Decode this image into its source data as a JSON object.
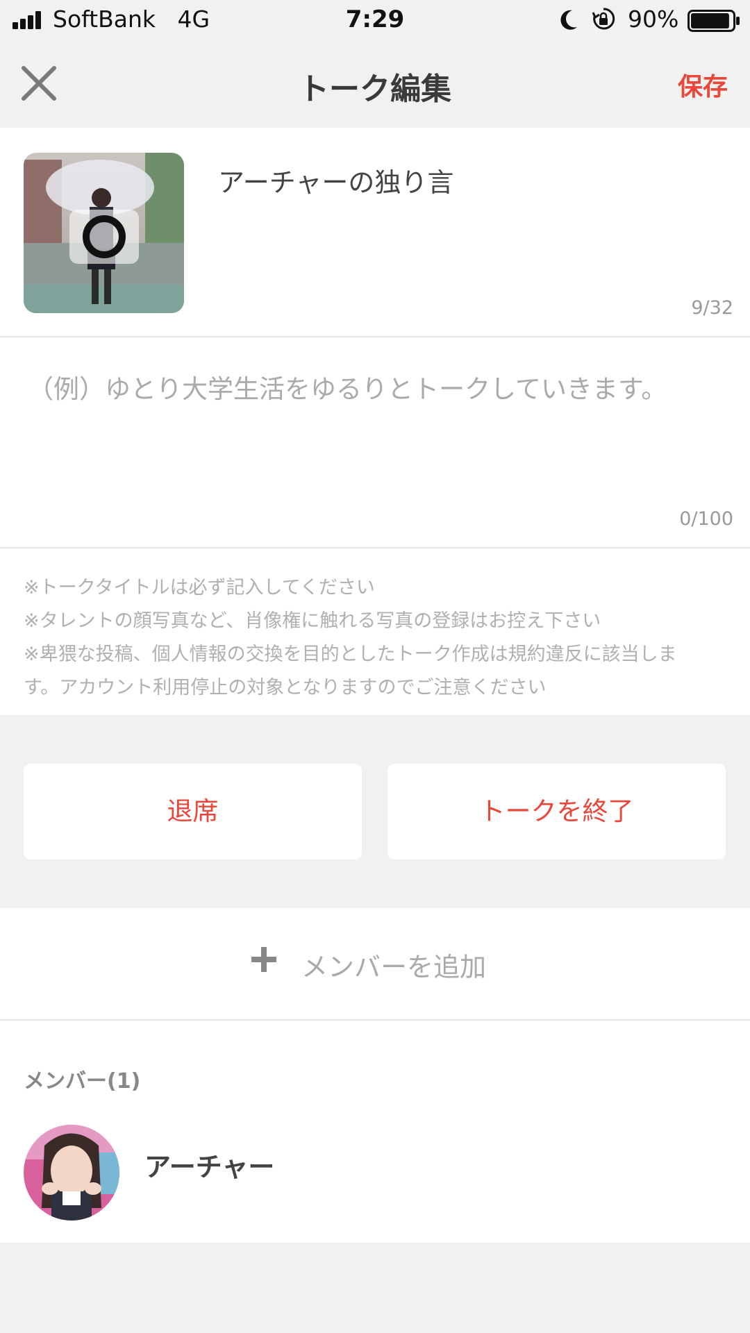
{
  "status_bar": {
    "carrier": "SoftBank",
    "network": "4G",
    "time": "7:29",
    "battery": "90%",
    "battery_level": 0.9
  },
  "nav": {
    "title": "トーク編集",
    "save_label": "保存",
    "close_icon": "close-icon"
  },
  "talk": {
    "title": "アーチャーの独り言",
    "title_counter": "9/32",
    "description_placeholder": "（例）ゆとり大学生活をゆるりとトークしていきます。",
    "description_counter": "0/100",
    "thumbnail_icon": "camera-icon"
  },
  "notes": [
    "※トークタイトルは必ず記入してください",
    "※タレントの顔写真など、肖像権に触れる写真の登録はお控え下さい",
    "※卑猥な投稿、個人情報の交換を目的としたトーク作成は規約違反に該当しま",
    "す。アカウント利用停止の対象となりますのでご注意ください"
  ],
  "actions": {
    "leave_label": "退席",
    "end_label": "トークを終了"
  },
  "add_member": {
    "label": "メンバーを追加",
    "icon": "plus-icon"
  },
  "members": {
    "header": "メンバー(1)",
    "list": [
      {
        "name": "アーチャー"
      }
    ]
  },
  "colors": {
    "accent": "#e8473a",
    "background": "#f1f1f1",
    "placeholder": "#aaaaaa"
  }
}
